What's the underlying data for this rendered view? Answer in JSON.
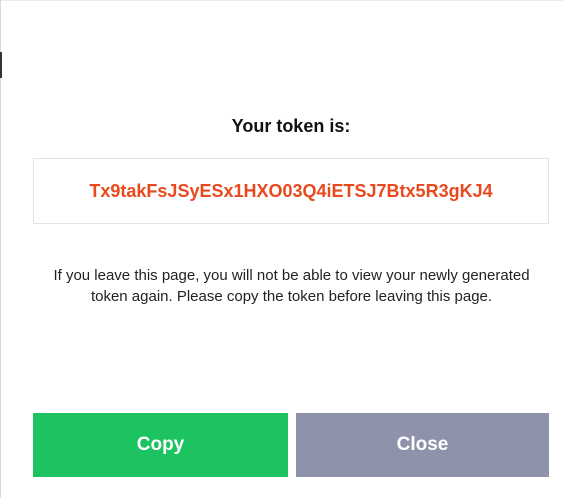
{
  "dialog": {
    "title": "Your token is:",
    "token": "Tx9takFsJSyESx1HXO03Q4iETSJ7Btx5R3gKJ4",
    "warning": "If you leave this page, you will not be able to view your newly generated token again. Please copy the token before leaving this page.",
    "copy_label": "Copy",
    "close_label": "Close"
  },
  "colors": {
    "token_text": "#e8491d",
    "copy_button": "#1cc360",
    "close_button": "#8e93ab"
  }
}
